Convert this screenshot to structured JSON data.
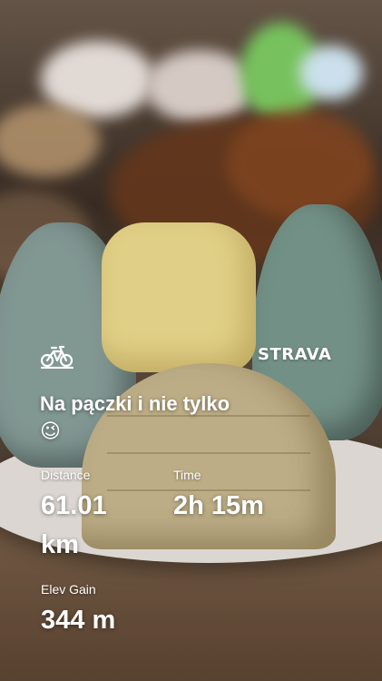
{
  "logo": "STRAVA",
  "activity_icon": "bike-icon",
  "title": "Na pączki i nie tylko",
  "emoji": "😉",
  "stats": {
    "distance": {
      "label": "Distance",
      "value": "61.01",
      "unit": "km"
    },
    "time": {
      "label": "Time",
      "value": "2h 15m"
    },
    "elev_gain": {
      "label": "Elev Gain",
      "value": "344 m"
    }
  },
  "colors": {
    "text": "#ffffff"
  }
}
